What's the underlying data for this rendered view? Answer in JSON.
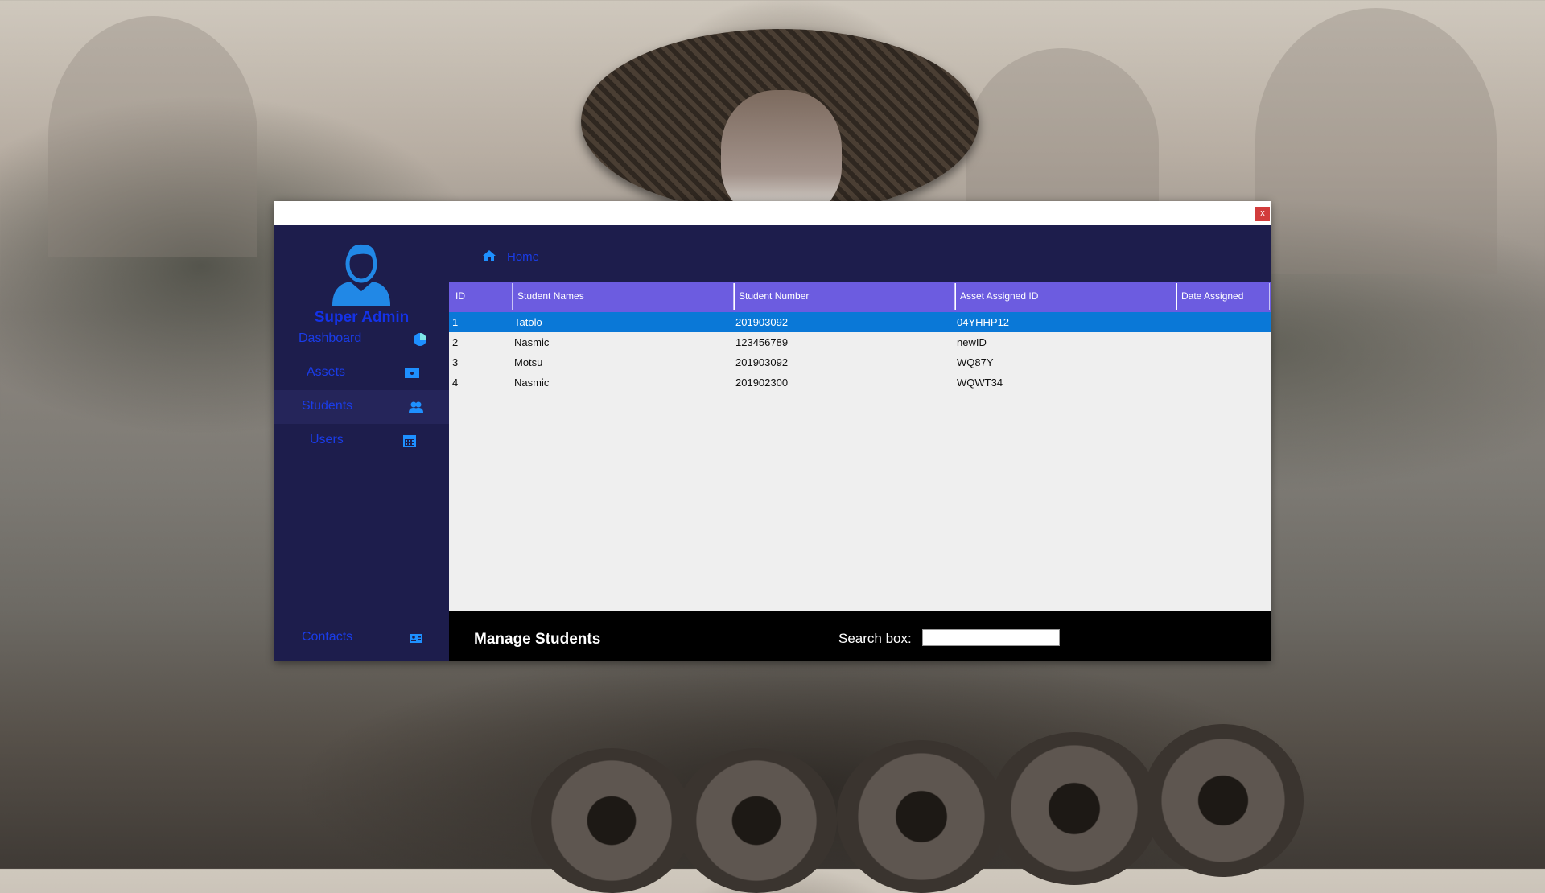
{
  "window": {
    "close_label": "x"
  },
  "sidebar": {
    "profile_name": "Super Admin",
    "items": [
      {
        "label": "Dashboard",
        "icon": "pie-chart-icon"
      },
      {
        "label": "Assets",
        "icon": "monitor-icon"
      },
      {
        "label": "Students",
        "icon": "users-icon",
        "active": true
      },
      {
        "label": "Users",
        "icon": "calendar-icon"
      }
    ],
    "contacts": {
      "label": "Contacts",
      "icon": "contact-card-icon"
    }
  },
  "topbar": {
    "home_label": "Home"
  },
  "table": {
    "columns": [
      "ID",
      "Student Names",
      "Student Number",
      "Asset Assigned ID",
      "Date Assigned"
    ],
    "rows": [
      {
        "id": "1",
        "name": "Tatolo",
        "number": "201903092",
        "asset": "04YHHP12",
        "date": "",
        "selected": true
      },
      {
        "id": "2",
        "name": "Nasmic",
        "number": "123456789",
        "asset": "newID",
        "date": ""
      },
      {
        "id": "3",
        "name": "Motsu",
        "number": "201903092",
        "asset": "WQ87Y",
        "date": ""
      },
      {
        "id": "4",
        "name": "Nasmic",
        "number": "201902300",
        "asset": "WQWT34",
        "date": ""
      }
    ]
  },
  "footer": {
    "title": "Manage Students",
    "search_label": "Search box:",
    "search_value": ""
  },
  "colors": {
    "sidebar_bg": "#1d1d4c",
    "header_bg": "#6c5ce0",
    "selected_row": "#0a78d7",
    "link_blue": "#1a3ce8",
    "icon_blue": "#1e90ff"
  }
}
